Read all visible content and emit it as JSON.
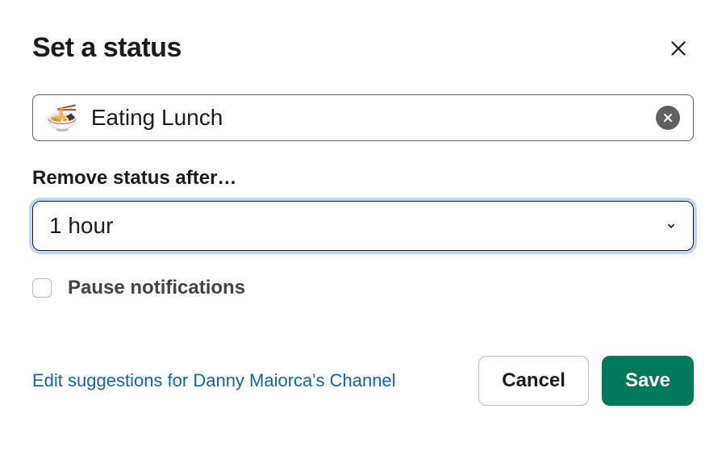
{
  "header": {
    "title": "Set a status"
  },
  "status": {
    "emoji": "🍜",
    "value": "Eating Lunch"
  },
  "duration": {
    "label": "Remove status after…",
    "selected": "1 hour"
  },
  "pause": {
    "label": "Pause notifications",
    "checked": false
  },
  "footer": {
    "edit_link": "Edit suggestions for Danny Maiorca's Channel",
    "cancel": "Cancel",
    "save": "Save"
  }
}
